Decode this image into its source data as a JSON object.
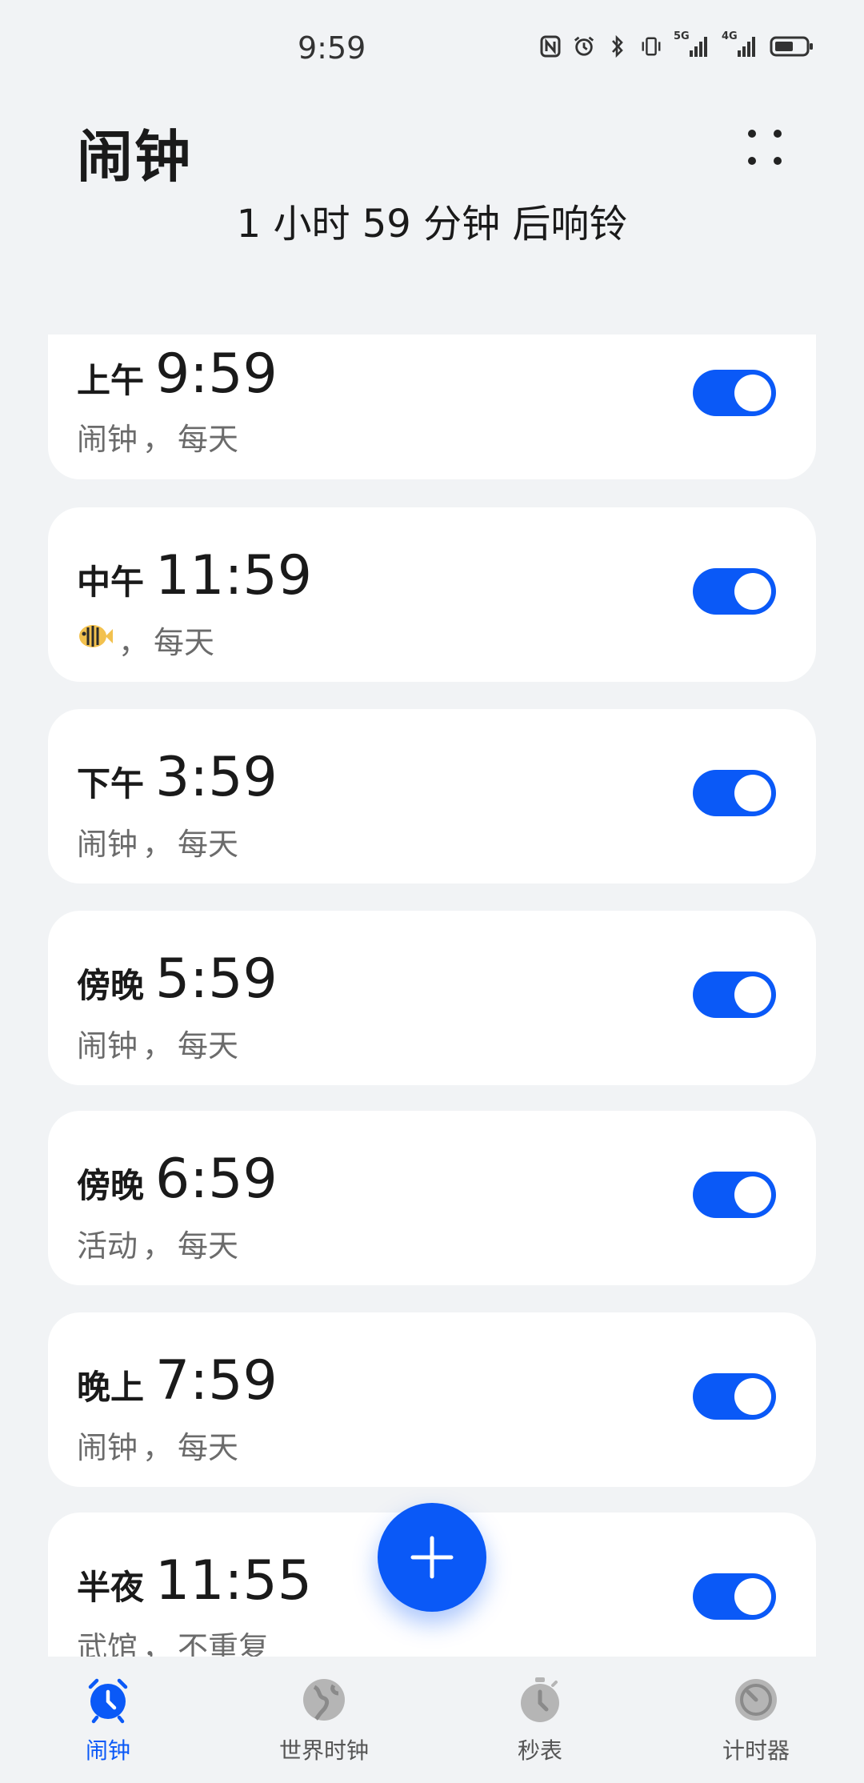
{
  "status": {
    "time": "9:59",
    "icons": [
      "nfc-icon",
      "alarm-icon",
      "bluetooth-icon",
      "vibrate-icon",
      "signal-5g-icon",
      "signal-4g-icon",
      "battery-icon"
    ],
    "signal_5g_label": "5G",
    "signal_4g_label": "4G"
  },
  "header": {
    "title": "闹钟",
    "next_alarm": "1 小时 59 分钟 后响铃"
  },
  "alarms": [
    {
      "period": "上午",
      "time": "9:59",
      "label": "闹钟",
      "repeat": "每天",
      "enabled": true
    },
    {
      "period": "中午",
      "time": "11:59",
      "label": "",
      "repeat": "每天",
      "enabled": true,
      "icon": "fish-icon"
    },
    {
      "period": "下午",
      "time": "3:59",
      "label": "闹钟",
      "repeat": "每天",
      "enabled": true
    },
    {
      "period": "傍晚",
      "time": "5:59",
      "label": "闹钟",
      "repeat": "每天",
      "enabled": true
    },
    {
      "period": "傍晚",
      "time": "6:59",
      "label": "活动",
      "repeat": "每天",
      "enabled": true
    },
    {
      "period": "晚上",
      "time": "7:59",
      "label": "闹钟",
      "repeat": "每天",
      "enabled": true
    },
    {
      "period": "半夜",
      "time": "11:55",
      "label": "武馆",
      "repeat": "不重复",
      "enabled": true
    }
  ],
  "separator": "，",
  "nav": {
    "items": [
      {
        "label": "闹钟",
        "icon": "alarm-clock-icon",
        "active": true
      },
      {
        "label": "世界时钟",
        "icon": "globe-icon",
        "active": false
      },
      {
        "label": "秒表",
        "icon": "stopwatch-icon",
        "active": false
      },
      {
        "label": "计时器",
        "icon": "timer-icon",
        "active": false
      }
    ]
  },
  "colors": {
    "accent": "#0a59f7",
    "background": "#f1f3f5",
    "card": "#ffffff",
    "secondary_text": "#6b6b6b"
  }
}
